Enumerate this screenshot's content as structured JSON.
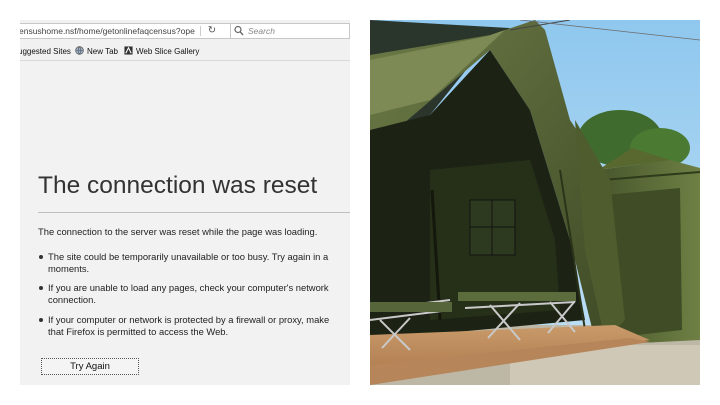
{
  "toolbar": {
    "url": "ensushome.nsf/home/getonlinefaqcensus?ope",
    "search_placeholder": "Search",
    "reload_icon": "reload-icon"
  },
  "bookmarks": {
    "items": [
      {
        "label": "uggested Sites",
        "icon": "suggested-sites-icon"
      },
      {
        "label": "New Tab",
        "icon": "globe-icon"
      },
      {
        "label": "Web Slice Gallery",
        "icon": "web-slice-icon"
      }
    ]
  },
  "error": {
    "title": "The connection was reset",
    "description": "The connection to the server was reset while the page was loading.",
    "bullets": [
      {
        "line1": "The site could be temporarily unavailable or too busy. Try again in a",
        "line2": "moments."
      },
      {
        "line1": "If you are unable to load any pages, check your computer's network",
        "line2": "connection."
      },
      {
        "line1": "If your computer or network is protected by a firewall or proxy, make",
        "line2": "that Firefox is permitted to access the Web."
      }
    ],
    "button_label": "Try Again"
  },
  "photo": {
    "subject": "military-tent-photo"
  }
}
